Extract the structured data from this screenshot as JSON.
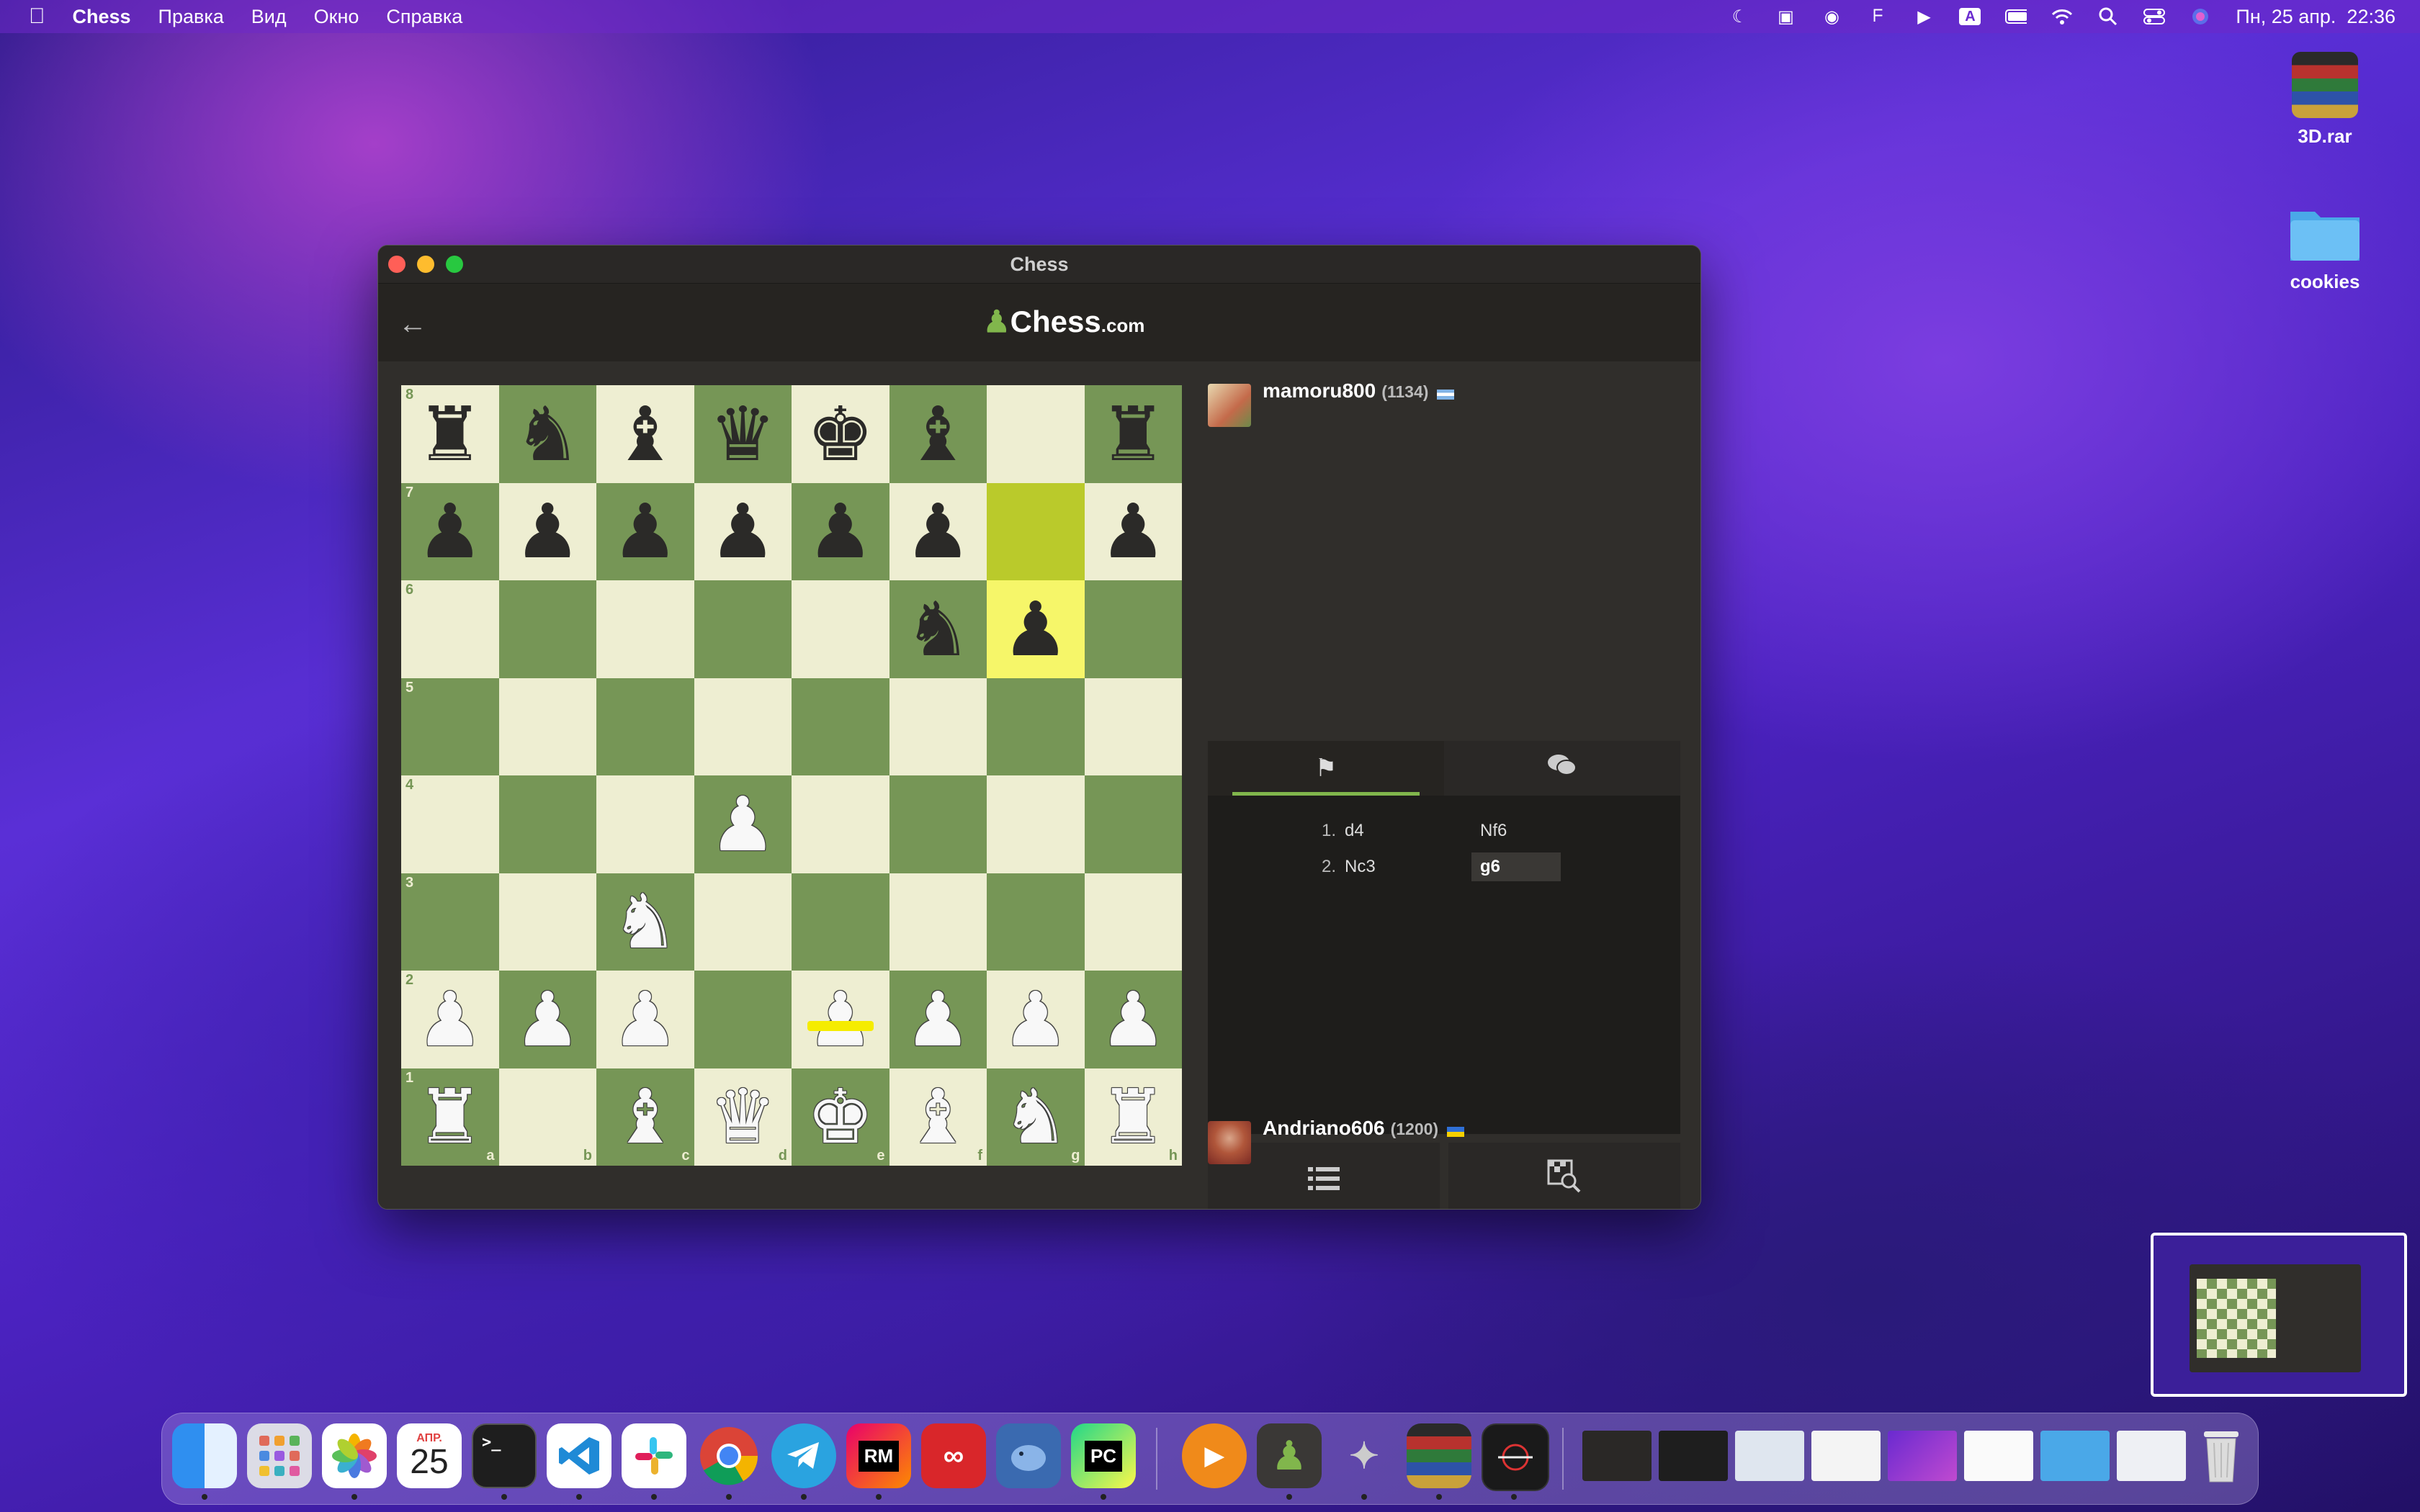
{
  "menubar": {
    "app_name": "Chess",
    "items": [
      "Правка",
      "Вид",
      "Окно",
      "Справка"
    ],
    "datetime": "Пн, 25 апр.  22:36",
    "keyboard_indicator": "A"
  },
  "desktop": {
    "icons": [
      {
        "label": "3D.rar",
        "icon": "rar-archive-icon"
      },
      {
        "label": "cookies",
        "icon": "folder-icon"
      }
    ]
  },
  "window": {
    "title": "Chess",
    "header": {
      "logo_text": "Chess",
      "logo_suffix": ".com",
      "back_icon": "arrow-left-icon"
    }
  },
  "board": {
    "rank_labels": [
      "8",
      "7",
      "6",
      "5",
      "4",
      "3",
      "2",
      "1"
    ],
    "file_labels": [
      "a",
      "b",
      "c",
      "d",
      "e",
      "f",
      "g",
      "h"
    ],
    "highlight_from": "g7",
    "highlight_to": "g6",
    "position": {
      "a8": "bR",
      "b8": "bN",
      "c8": "bB",
      "d8": "bQ",
      "e8": "bK",
      "f8": "bB",
      "h8": "bR",
      "a7": "bP",
      "b7": "bP",
      "c7": "bP",
      "d7": "bP",
      "e7": "bP",
      "f7": "bP",
      "h7": "bP",
      "f6": "bN",
      "g6": "bP",
      "d4": "wP",
      "c3": "wN",
      "a2": "wP",
      "b2": "wP",
      "c2": "wP",
      "e2": "wP",
      "f2": "wP",
      "g2": "wP",
      "h2": "wP",
      "a1": "wR",
      "c1": "wB",
      "d1": "wQ",
      "e1": "wK",
      "f1": "wB",
      "g1": "wN",
      "h1": "wR"
    }
  },
  "top_player": {
    "name": "mamoru800",
    "rating": "(1134)"
  },
  "bottom_player": {
    "name": "Andriano606",
    "rating": "(1200)"
  },
  "tabs": [
    {
      "icon": "move-list-icon",
      "active": true
    },
    {
      "icon": "chat-icon",
      "active": false
    }
  ],
  "moves": [
    {
      "num": "1.",
      "white": "d4",
      "black": "Nf6"
    },
    {
      "num": "2.",
      "white": "Nc3",
      "black": "g6"
    }
  ],
  "controls": [
    {
      "icon": "list-icon"
    },
    {
      "icon": "analysis-icon"
    },
    {
      "icon": "chevron-left-icon"
    },
    {
      "icon": "chevron-right-icon"
    }
  ],
  "dock": {
    "calendar_month": "АПР.",
    "calendar_day": "25",
    "pycharm_label": "PC",
    "rubymine_label": "RM"
  },
  "colors": {
    "light_square": "#eeeed2",
    "dark_square": "#769656",
    "accent": "#81b64c"
  }
}
